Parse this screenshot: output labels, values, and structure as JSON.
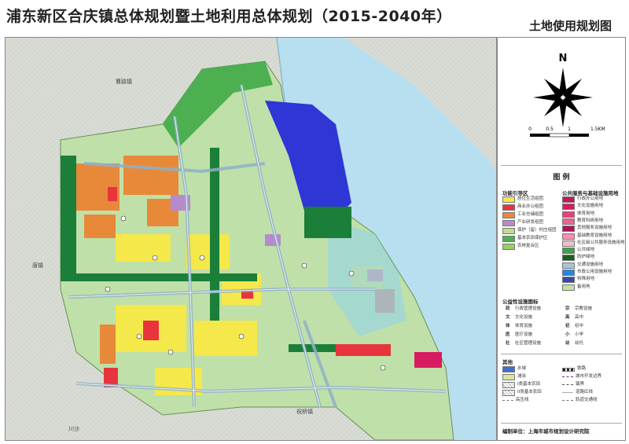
{
  "title": "浦东新区合庆镇总体规划暨土地利用总体规划（2015-2040年）",
  "subtitle": "土地使用规划图",
  "north_label": "N",
  "scale": {
    "ticks": [
      "0",
      "0.5",
      "1",
      "1.5KM"
    ]
  },
  "legend": {
    "heading": "图 例",
    "functional_zones": {
      "title": "功能引导区",
      "items": [
        {
          "label": "居住生活组团",
          "color": "#f5e84a"
        },
        {
          "label": "商业办公组团",
          "color": "#e8343c"
        },
        {
          "label": "工业仓储组团",
          "color": "#e8893a"
        },
        {
          "label": "产业研发组团",
          "color": "#b58ccb"
        },
        {
          "label": "保护（留）村庄组团",
          "color": "#c4d98a"
        },
        {
          "label": "基本农田保护区",
          "color": "#4caf50"
        },
        {
          "label": "农林复合区",
          "color": "#9ccc65"
        }
      ]
    },
    "public_service_land": {
      "title": "公共服务与基础设施用地",
      "items": [
        {
          "label": "行政办公用地",
          "color": "#c2185b"
        },
        {
          "label": "文化设施用地",
          "color": "#d81b60"
        },
        {
          "label": "体育用地",
          "color": "#ec407a"
        },
        {
          "label": "教育科研用地",
          "color": "#f06292"
        },
        {
          "label": "其他服务设施用地",
          "color": "#ad1457"
        },
        {
          "label": "基础教育设施用地",
          "color": "#f48fb1"
        },
        {
          "label": "社区级公共服务设施用地",
          "color": "#f8bbd0"
        },
        {
          "label": "公共绿地",
          "color": "#43a047"
        },
        {
          "label": "防护绿地",
          "color": "#1b5e20"
        },
        {
          "label": "交通设施用地",
          "color": "#a8c4d8"
        },
        {
          "label": "市政公用设施用地",
          "color": "#1e88e5"
        },
        {
          "label": "特殊用地",
          "color": "#3949ab"
        },
        {
          "label": "备用地",
          "color": "#c5e1a5"
        }
      ]
    },
    "facility_icons": {
      "title": "公益性设施图标",
      "items": [
        {
          "symbol": "政",
          "label": "行政管理设施"
        },
        {
          "symbol": "宗",
          "label": "宗教设施"
        },
        {
          "symbol": "文",
          "label": "文化设施"
        },
        {
          "symbol": "高",
          "label": "高中"
        },
        {
          "symbol": "体",
          "label": "体育设施"
        },
        {
          "symbol": "初",
          "label": "初中"
        },
        {
          "symbol": "医",
          "label": "医疗设施"
        },
        {
          "symbol": "小",
          "label": "小学"
        },
        {
          "symbol": "社",
          "label": "社区管理设施"
        },
        {
          "symbol": "幼",
          "label": "幼托"
        }
      ]
    },
    "other": {
      "title": "其他",
      "items": [
        {
          "label": "水域",
          "color": "#3f6fd1",
          "kind": "fill"
        },
        {
          "label": "铁路",
          "color": "#222222",
          "kind": "rail"
        },
        {
          "label": "滩涂",
          "color": "#d9e6a0",
          "kind": "fill"
        },
        {
          "label": "城市开发边界",
          "color": "#7b1fa2",
          "kind": "dash"
        },
        {
          "label": "I类基本农田",
          "color": "#ffffff",
          "kind": "hatch"
        },
        {
          "label": "镇界",
          "color": "#555555",
          "kind": "dash"
        },
        {
          "label": "II类基本农田",
          "color": "#ffffff",
          "kind": "hatch"
        },
        {
          "label": "道路红线",
          "color": "#aaaaaa",
          "kind": "line"
        },
        {
          "label": "高压线",
          "color": "#777777",
          "kind": "dash"
        },
        {
          "label": "轨道交通线",
          "color": "#777777",
          "kind": "dash"
        }
      ]
    }
  },
  "credit": "编制单位：上海市城市规划设计研究院",
  "map_labels": [
    {
      "text": "曹路镇"
    },
    {
      "text": "唐镇"
    },
    {
      "text": "祝桥镇"
    },
    {
      "text": "川沙"
    }
  ]
}
